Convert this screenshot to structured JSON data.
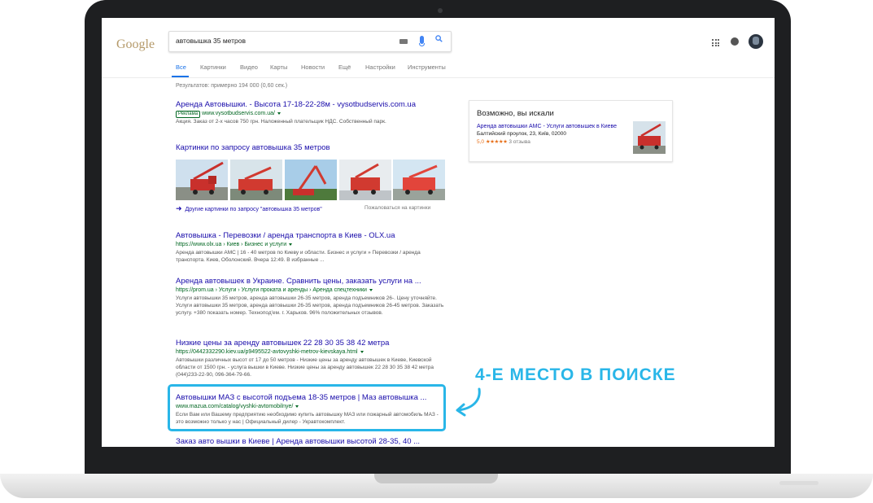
{
  "search": {
    "query": "автовышка 35 метров"
  },
  "logo_text": "Google",
  "tabs": [
    {
      "label": "Все",
      "active": true
    },
    {
      "label": "Картинки"
    },
    {
      "label": "Видео"
    },
    {
      "label": "Карты"
    },
    {
      "label": "Новости"
    },
    {
      "label": "Ещё"
    },
    {
      "label": "Настройки"
    },
    {
      "label": "Инструменты"
    }
  ],
  "result_stats": "Результатов: примерно 194 000 (0,60 сек.)",
  "ad": {
    "title": "Аренда Автовышки. - Высота 17-18-22-28м - vysotbudservis.com.ua",
    "badge": "Реклама",
    "url": "www.vysotbudservis.com.ua/",
    "snippet": "Акция. Заказ от 2-х часов 750 грн. Наложенный плательщик НДС. Собственный парк."
  },
  "images_block": {
    "title": "Картинки по запросу автовышка 35 метров",
    "more_link": "Другие картинки по запросу \"автовышка 35 метров\"",
    "report": "Пожаловаться на картинки"
  },
  "results": [
    {
      "title": "Автовышка - Перевозки / аренда транспорта в Киев - OLX.ua",
      "url": "https://www.olx.ua › Киев › Бизнес и услуги",
      "snippet": "Аренда автовышки АМС | 16 - 40 метров по Киеву и области. Бизнес и услуги » Перевозки / аренда транспорта. Киев, Оболонский. Вчера 12:49. В избранные ..."
    },
    {
      "title": "Аренда автовышек в Украине. Сравнить цены, заказать услуги на ...",
      "url": "https://prom.ua › Услуги › Услуги проката и аренды › Аренда спецтехники",
      "snippet": "Услуги автовышки 35 метров, аренда автовышки 26-35 метров, аренда подъемников 26-. Цену уточняйте. Услуги автовышки 35 метров, аренда автовышки 26-35 метров, аренда подъемников 26-45 метров. Заказать услугу. +380 показать номер. Технопод'ем. г. Харьков. 96% положительных отзывов."
    },
    {
      "title": "Низкие цены за аренду автовышек 22 28 30 35 38 42 метра",
      "url": "https://0442332290.kiev.ua/p9495522-avtovyshki-metrov-kievskaya.html",
      "snippet": "Автовышки различных высот от 17 до 50 метров - Низкие цены за аренду автовышек в Киеве, Киевской области от 1500 грн. - услуга вышки в Киеве. Низкие цены за аренду автовышек 22 28 30 35 38 42 метра (044)233-22-90, 096-364-79-66."
    },
    {
      "title": "Автовышки МАЗ с высотой подъема 18-35 метров | Маз автовышка ...",
      "url": "www.mazua.com/catalog/vyshki-avtomobilnye/",
      "snippet": "Если Вам или Вашему предприятию необходимо купить автовышку МАЗ или пожарный автомобиль МАЗ - это возможно только у нас | Официальный дилер - Укравтокомплект."
    },
    {
      "title": "Заказ авто вышки в Киеве | Аренда автовышки высотой 28-35, 40 ..."
    }
  ],
  "knowledge_panel": {
    "heading": "Возможно, вы искали",
    "link": "Аренда автовышки АМС - Услуги автовышек в Киеве",
    "address": "Балтийский проулок, 23, Київ, 02000",
    "rating": "5,0",
    "stars": "★★★★★",
    "reviews": "3 отзыва"
  },
  "annotation": {
    "text": "4-Е МЕСТО В ПОИСКЕ",
    "color": "#29b6e8"
  },
  "colors": {
    "link": "#1a0dab",
    "url": "#006621",
    "accent": "#1a73e8",
    "highlight": "#29b6e8"
  }
}
